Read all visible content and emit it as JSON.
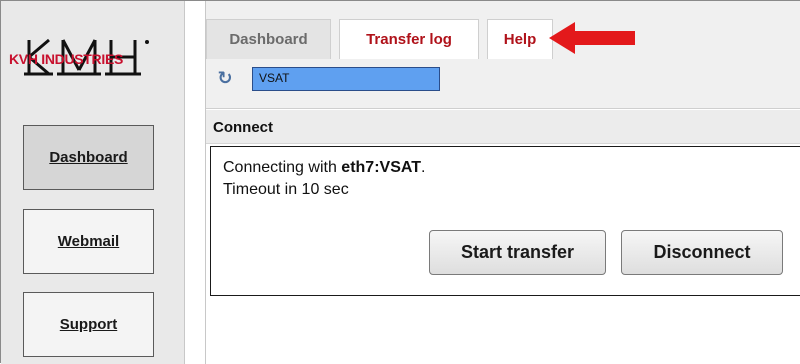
{
  "sidebar": {
    "logo_text": "KVH INDUSTRIES",
    "logo_alt": "KVH",
    "items": [
      {
        "label": "Dashboard",
        "active": true
      },
      {
        "label": "Webmail",
        "active": false
      },
      {
        "label": "Support",
        "active": false
      }
    ]
  },
  "tabs": [
    {
      "label": "Dashboard"
    },
    {
      "label": "Transfer log"
    },
    {
      "label": "Help"
    }
  ],
  "connection": {
    "icon": "refresh-icon",
    "value": "VSAT"
  },
  "connect": {
    "header": "Connect",
    "status_prefix": "Connecting with ",
    "status_target": "eth7:VSAT",
    "status_suffix": ".",
    "timeout": "Timeout in 10 sec"
  },
  "buttons": {
    "start": "Start transfer",
    "disconnect": "Disconnect"
  },
  "colors": {
    "brand_red": "#c8102e",
    "tab_red": "#b0121a",
    "field_blue": "#5fa0f0",
    "arrow_red": "#e3191b"
  },
  "annotation": {
    "icon": "red-arrow-icon"
  }
}
